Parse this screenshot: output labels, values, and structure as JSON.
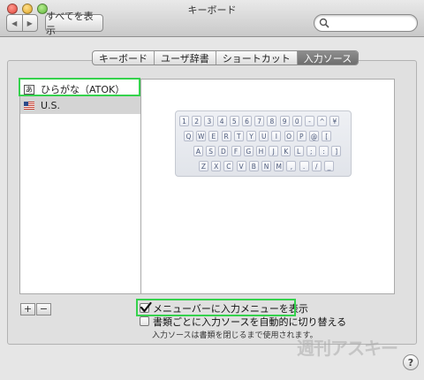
{
  "window": {
    "title": "キーボード"
  },
  "toolbar": {
    "show_all_label": "すべてを表示",
    "back_glyph": "◀",
    "forward_glyph": "▶",
    "search_placeholder": ""
  },
  "tabs": [
    {
      "label": "キーボード",
      "active": false
    },
    {
      "label": "ユーザ辞書",
      "active": false
    },
    {
      "label": "ショートカット",
      "active": false
    },
    {
      "label": "入力ソース",
      "active": true
    }
  ],
  "sources": [
    {
      "label": "ひらがな（ATOK）",
      "icon": "hiragana-input-icon",
      "icon_text": "あ",
      "highlighted": true
    },
    {
      "label": "U.S.",
      "icon": "us-flag-icon",
      "selected": true
    }
  ],
  "keyboard": {
    "rows": [
      [
        "1",
        "2",
        "3",
        "4",
        "5",
        "6",
        "7",
        "8",
        "9",
        "0",
        "-",
        "^",
        "¥"
      ],
      [
        "Q",
        "W",
        "E",
        "R",
        "T",
        "Y",
        "U",
        "I",
        "O",
        "P",
        "@",
        "["
      ],
      [
        "A",
        "S",
        "D",
        "F",
        "G",
        "H",
        "J",
        "K",
        "L",
        ";",
        ":",
        "]"
      ],
      [
        "Z",
        "X",
        "C",
        "V",
        "B",
        "N",
        "M",
        ",",
        ".",
        "/",
        "_"
      ]
    ]
  },
  "list_controls": {
    "add_label": "+",
    "remove_label": "−"
  },
  "options": {
    "show_input_menu": {
      "label": "メニューバーに入力メニューを表示",
      "checked": true
    },
    "auto_switch": {
      "label": "書類ごとに入力ソースを自動的に切り替える",
      "checked": false
    },
    "auto_switch_note": "入力ソースは書類を閉じるまで使用されます。"
  },
  "watermark": "週刊アスキー",
  "help_label": "?",
  "colors": {
    "highlight": "#35d24d",
    "selected_row": "#d4d4d4",
    "active_tab": "#7a7a7a"
  }
}
